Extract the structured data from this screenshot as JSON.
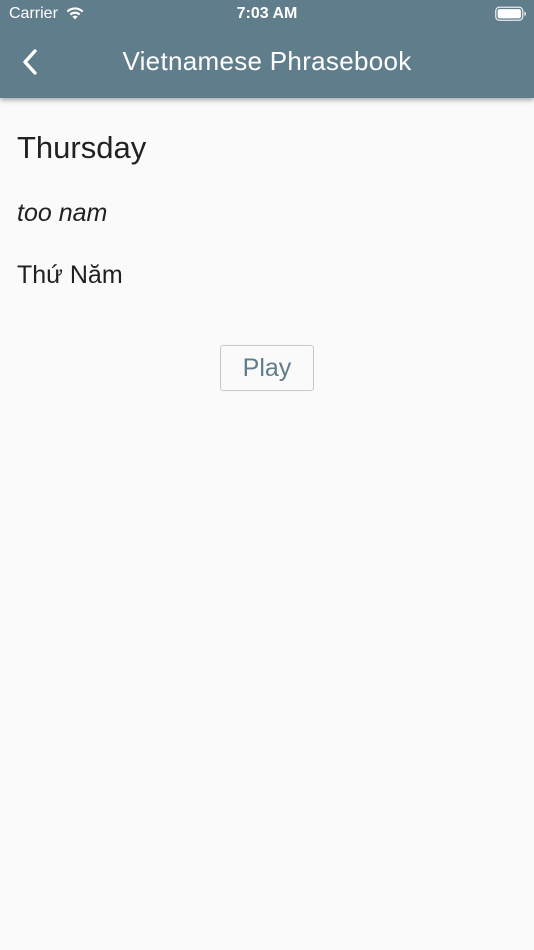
{
  "status_bar": {
    "carrier": "Carrier",
    "time": "7:03 AM",
    "icons": [
      "wifi-icon",
      "battery-icon"
    ]
  },
  "header": {
    "title": "Vietnamese Phrasebook",
    "back_icon": "chevron-left-icon",
    "background_color": "#607d8b"
  },
  "phrase": {
    "english": "Thursday",
    "pronunciation": "too nam",
    "vietnamese": "Thứ Năm"
  },
  "actions": {
    "play_label": "Play",
    "accent_color": "#607d8b"
  }
}
